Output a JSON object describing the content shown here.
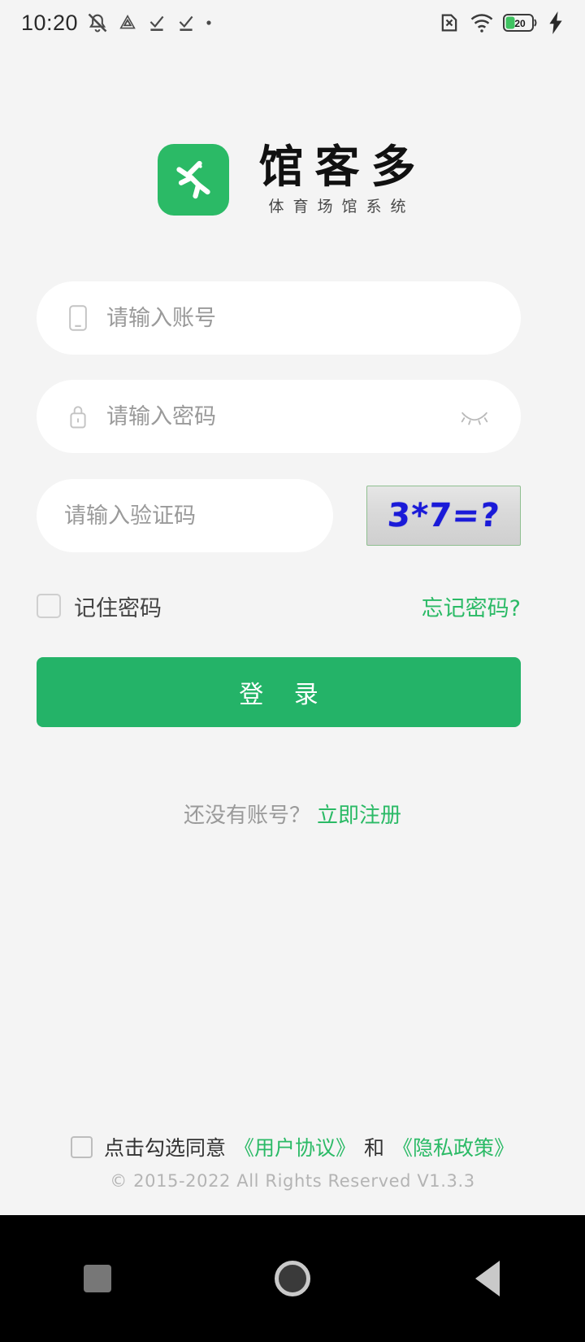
{
  "status_bar": {
    "time": "10:20",
    "left_icons": [
      "mute-icon",
      "drive-triangle-icon",
      "task-check-icon",
      "task-check-icon",
      "dot-icon"
    ],
    "right_icons": [
      "sim-error-icon",
      "wifi-icon",
      "battery-icon",
      "charging-bolt-icon"
    ],
    "battery_level": "20"
  },
  "logo": {
    "title": "馆客多",
    "subtitle": "体育场馆系统",
    "mark_icon": "running-person-icon",
    "brand_color": "#2bba66"
  },
  "form": {
    "account": {
      "icon": "mobile-phone-icon",
      "placeholder": "请输入账号",
      "value": ""
    },
    "password": {
      "icon": "lock-icon",
      "placeholder": "请输入密码",
      "value": "",
      "toggle_icon": "eye-closed-icon"
    },
    "captcha": {
      "placeholder": "请输入验证码",
      "value": "",
      "image_text": "3*7=?",
      "image_text_color": "#1a1ad8"
    },
    "remember": {
      "label": "记住密码",
      "checked": false
    },
    "forgot_label": "忘记密码?",
    "login_label": "登 录",
    "login_color": "#24b368"
  },
  "register": {
    "hint": "还没有账号？",
    "link": "立即注册"
  },
  "footer": {
    "agree_checked": false,
    "agree_prefix": "点击勾选同意",
    "user_agreement": "《用户协议》",
    "conjunction": "和",
    "privacy_policy": "《隐私政策》",
    "copyright": "© 2015-2022 All   Rights Reserved   V1.3.3"
  },
  "navbar": {
    "recents": "recents-square-icon",
    "home": "home-circle-icon",
    "back": "back-triangle-icon"
  }
}
